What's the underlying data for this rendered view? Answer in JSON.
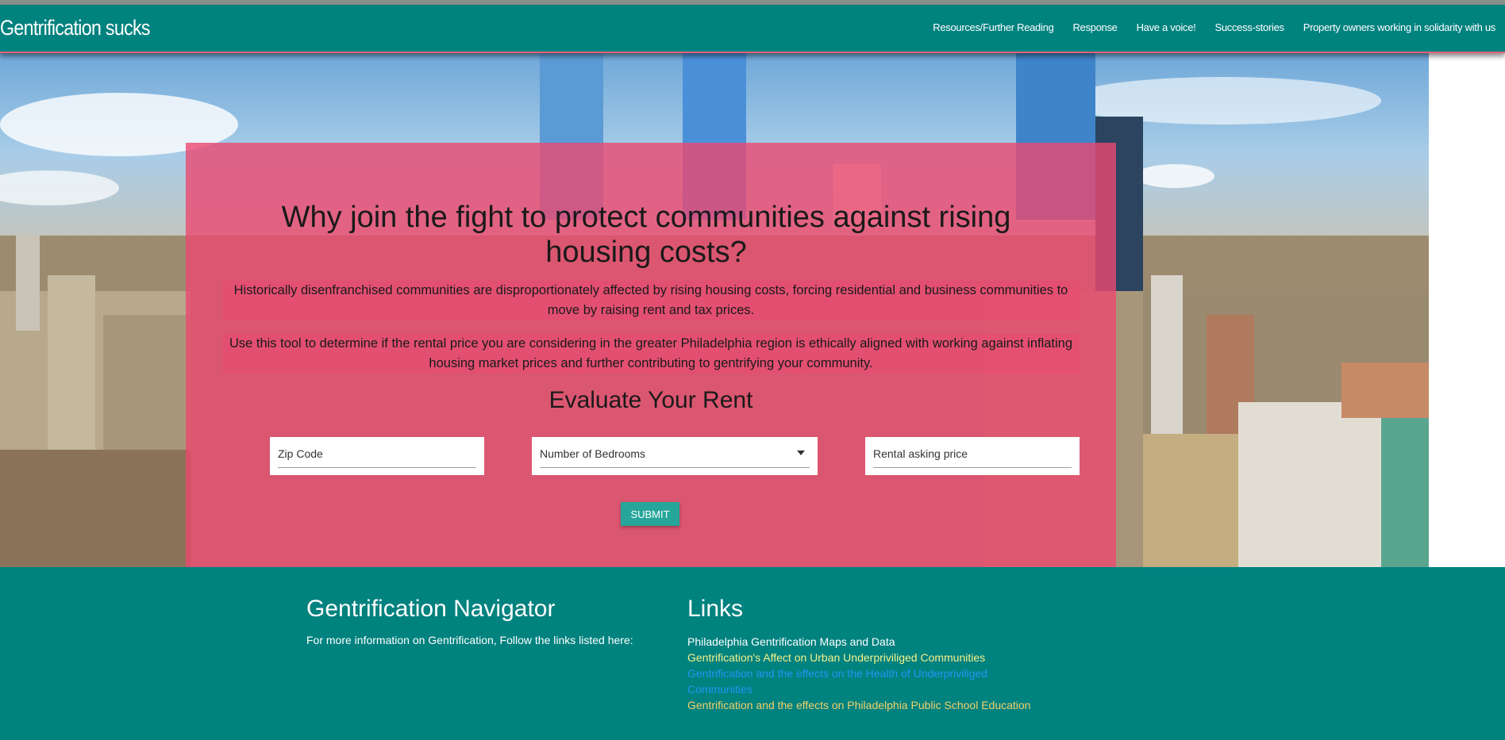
{
  "navbar": {
    "brand": "Gentrification sucks",
    "links": [
      "Resources/Further Reading",
      "Response",
      "Have a voice!",
      "Success-stories",
      "Property owners working in solidarity with us"
    ]
  },
  "hero": {
    "title": "Why join the fight to protect communities against rising housing costs?",
    "paragraph1": "Historically disenfranchised communities are disproportionately affected by rising housing costs, forcing residential and business communities to move by raising rent and tax prices.",
    "paragraph2": "Use this tool to determine if the rental price you are considering in the greater Philadelphia region is ethically aligned with working against inflating housing market prices and further contributing to gentrifying your community.",
    "form_title": "Evaluate Your Rent",
    "zip_placeholder": "Zip Code",
    "bedrooms_placeholder": "Number of Bedrooms",
    "price_placeholder": "Rental asking price",
    "submit_label": "SUBMIT"
  },
  "footer": {
    "col1_title": "Gentrification Navigator",
    "col1_text": "For more information on Gentrification, Follow the links listed here:",
    "col2_title": "Links",
    "links": [
      {
        "label": "Philadelphia Gentrification Maps and Data",
        "color": "#ffffff"
      },
      {
        "label": "Gentrification's Affect on Urban Underpriviliged Communities",
        "color": "#f4f18b"
      },
      {
        "label": "Gentrification and the effects on the Health of Underpriviliged Communities",
        "color": "#2196f3"
      },
      {
        "label": "Gentrification and the effects on Philadelphia Public School Education",
        "color": "#f2d06b"
      }
    ]
  },
  "colors": {
    "teal": "#00827f",
    "card_pink": "#eb4871",
    "button": "#26a69a"
  }
}
